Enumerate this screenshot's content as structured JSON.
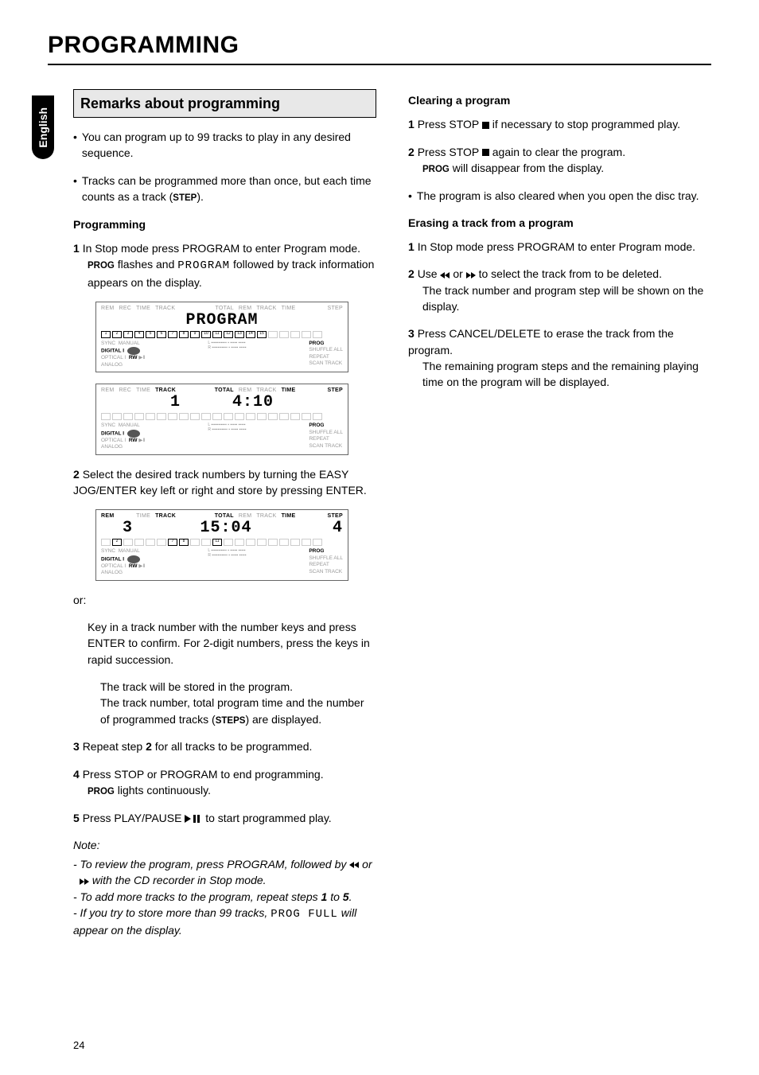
{
  "chapter_title": "PROGRAMMING",
  "lang_tab": "English",
  "page_number": "24",
  "left": {
    "section_heading": "Remarks about programming",
    "bullet1_a": "You can program up to 99 tracks to play in any desired sequence.",
    "bullet2_a": "Tracks can be programmed more than once, but each time counts as a track (",
    "bullet2_b": "STEP",
    "bullet2_c": ").",
    "subhead": "Programming",
    "s1_num": "1",
    "s1_a": "In Stop mode press PROGRAM to enter Program mode.",
    "s1_b": "PROG",
    "s1_c": " flashes and ",
    "s1_d": "PROGRAM",
    "s1_e": " followed by track information appears on the display.",
    "s2_num": "2",
    "s2_a": "Select the desired track numbers by turning the EASY JOG/ENTER key left or right and store by pressing ENTER.",
    "or_label": "or:",
    "or_a": "Key in a track number with the number keys and press ENTER to confirm. For 2-digit numbers, press the keys in rapid succession.",
    "or_b": "The track will be stored in the program.",
    "or_c": "The track number, total program time and the number of programmed tracks (",
    "or_d": "STEPS",
    "or_e": ") are displayed.",
    "s3_num": "3",
    "s3_a": "Repeat step ",
    "s3_b": "2",
    "s3_c": " for all tracks to be programmed.",
    "s4_num": "4",
    "s4_a": "Press STOP or PROGRAM to end programming.",
    "s4_b": "PROG",
    "s4_c": " lights continuously.",
    "s5_num": "5",
    "s5_a": "Press PLAY/PAUSE ",
    "s5_b": " to start programmed play.",
    "note_label": "Note:",
    "note1_a": "- To review the program, press PROGRAM, followed by ",
    "note1_b": " or ",
    "note1_c": " with the CD recorder in Stop mode.",
    "note2_a": "- To add more tracks to the program, repeat steps ",
    "note2_b": "1",
    "note2_c": " to ",
    "note2_d": "5",
    "note2_e": ".",
    "note3_a": "- If you try to store more than 99 tracks, ",
    "note3_b": "PROG FULL",
    "note3_c": " will appear on the display."
  },
  "right": {
    "clearing_head": "Clearing a program",
    "c1_num": "1",
    "c1_a": "Press STOP ",
    "c1_b": " if necessary to stop programmed play.",
    "c2_num": "2",
    "c2_a": "Press STOP ",
    "c2_b": " again to clear the program.",
    "c2_c": "PROG",
    "c2_d": " will disappear from the display.",
    "c3_a": "The program is also cleared when you open the disc tray.",
    "erasing_head": "Erasing a track from a program",
    "e1_num": "1",
    "e1_a": "In Stop mode press PROGRAM to enter Program mode.",
    "e2_num": "2",
    "e2_a": "Use ",
    "e2_b": " or ",
    "e2_c": " to select the track from to be deleted.",
    "e2_d": "The track number and program step will be shown on the display.",
    "e3_num": "3",
    "e3_a": "Press CANCEL/DELETE to erase the track from the program.",
    "e3_b": "The remaining program steps and the remaining playing time on the program will be displayed."
  },
  "lcd": {
    "top_labels": [
      "REM",
      "REC",
      "TIME",
      "TRACK",
      "TOTAL",
      "REM",
      "TRACK",
      "TIME"
    ],
    "right_labels": [
      "",
      "STEP"
    ],
    "bottom_left": [
      "SYNC",
      "MANUAL",
      "DIGITAL I",
      "OPTICAL I",
      "ANALOG",
      "RW"
    ],
    "bottom_right": [
      "PROG",
      "SHUFFLE   ALL",
      "REPEAT",
      "SCAN   TRACK"
    ],
    "panel1_main": "PROGRAM",
    "panel2_main_a": "1",
    "panel2_main_b": "4:10",
    "panel3_main_a": "3",
    "panel3_main_b": "15:04",
    "panel3_step": "4"
  }
}
